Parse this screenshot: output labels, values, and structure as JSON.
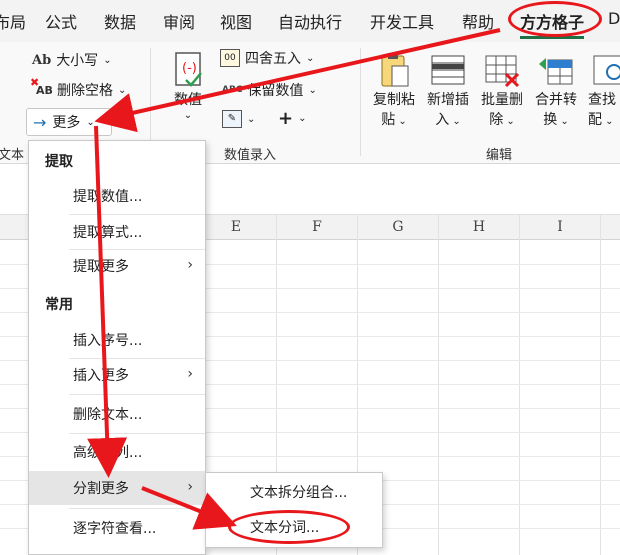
{
  "tabs": [
    {
      "label": "布局",
      "active": false
    },
    {
      "label": "公式",
      "active": false
    },
    {
      "label": "数据",
      "active": false
    },
    {
      "label": "审阅",
      "active": false
    },
    {
      "label": "视图",
      "active": false
    },
    {
      "label": "自动执行",
      "active": false
    },
    {
      "label": "开发工具",
      "active": false
    },
    {
      "label": "帮助",
      "active": false
    },
    {
      "label": "方方格子",
      "active": true
    },
    {
      "label": "D",
      "active": false
    }
  ],
  "ribbon": {
    "text_group": {
      "case_label": "大小写",
      "case_icon_text": "Ab",
      "remove_spaces_label": "删除空格",
      "remove_spaces_icon_text": "AB",
      "more_label": "更多",
      "group_label": "文本"
    },
    "numeric_group": {
      "numeric_label": "数值",
      "round_label": "四舍五入",
      "keep_value_label": "保留数值",
      "keep_value_icon_text": "ABC",
      "group_label": "数值录入"
    },
    "edit_group": {
      "copy_paste_label_1": "复制粘",
      "copy_paste_label_2": "贴",
      "insert_label_1": "新增插",
      "insert_label_2": "入",
      "batch_delete_label_1": "批量删",
      "batch_delete_label_2": "除",
      "merge_label_1": "合并转",
      "merge_label_2": "换",
      "find_label_1": "查找",
      "find_label_2": "配",
      "group_label": "编辑"
    }
  },
  "sheet": {
    "column_headers": [
      "E",
      "F",
      "G",
      "H",
      "I"
    ]
  },
  "menu": {
    "section_extract": "提取",
    "extract_items": [
      {
        "label": "提取数值...",
        "has_submenu": false
      },
      {
        "label": "提取算式...",
        "has_submenu": false
      },
      {
        "label": "提取更多",
        "has_submenu": true
      }
    ],
    "section_common": "常用",
    "common_items": [
      {
        "label": "插入序号...",
        "has_submenu": false
      },
      {
        "label": "插入更多",
        "has_submenu": true
      },
      {
        "label": "删除文本...",
        "has_submenu": false
      },
      {
        "label": "高级分列...",
        "has_submenu": false
      },
      {
        "label": "分割更多",
        "has_submenu": true,
        "highlighted": true
      },
      {
        "label": "逐字符查看...",
        "has_submenu": false
      }
    ]
  },
  "submenu": {
    "items": [
      {
        "label": "文本拆分组合..."
      },
      {
        "label": "文本分词..."
      }
    ]
  },
  "colors": {
    "annotation_red": "#e8171b",
    "accent_green": "#1e7145",
    "highlight": "#e5e5e5"
  }
}
